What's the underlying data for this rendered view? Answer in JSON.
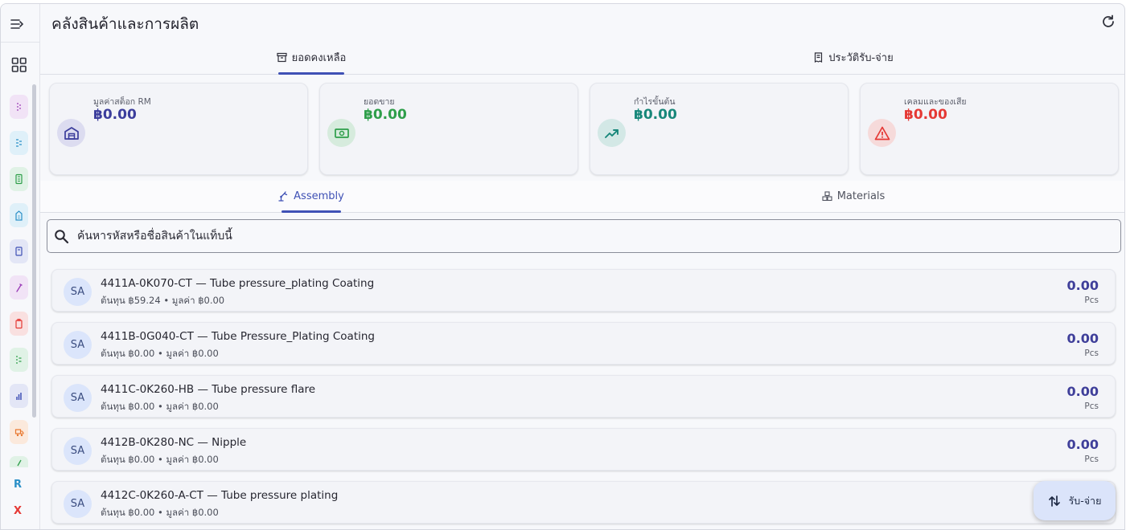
{
  "header": {
    "title": "คลังสินค้าและการผลิต"
  },
  "top_tabs": [
    {
      "label": "ยอดคงเหลือ",
      "icon": "archive-icon",
      "active": true
    },
    {
      "label": "ประวัติรับ-จ่าย",
      "icon": "receipt-icon",
      "active": false
    }
  ],
  "stats": [
    {
      "label": "มูลค่าสต็อก RM",
      "value": "฿0.00",
      "icon": "warehouse-icon",
      "color": "#3b3d9c",
      "icon_bg": "#dcdcf0"
    },
    {
      "label": "ยอดขาย",
      "value": "฿0.00",
      "icon": "cash-icon",
      "color": "#2e9e4a",
      "icon_bg": "#d6ebdd"
    },
    {
      "label": "กำไรขั้นต้น",
      "value": "฿0.00",
      "icon": "trending-up-icon",
      "color": "#17877a",
      "icon_bg": "#d3e8e6"
    },
    {
      "label": "เคลมและของเสีย",
      "value": "฿0.00",
      "icon": "warning-icon",
      "color": "#e53935",
      "icon_bg": "#f6dada"
    }
  ],
  "sub_tabs": [
    {
      "label": "Assembly",
      "icon": "assembly-icon",
      "active": true
    },
    {
      "label": "Materials",
      "icon": "materials-icon",
      "active": false
    }
  ],
  "search": {
    "placeholder": "ค้นหารหัสหรือชื่อสินค้าในแท็บนี้"
  },
  "items": [
    {
      "avatar": "SA",
      "title": "4411A-0K070-CT — Tube pressure_plating Coating",
      "subtitle": "ต้นทุน ฿59.24 • มูลค่า ฿0.00",
      "qty": "0.00",
      "unit": "Pcs"
    },
    {
      "avatar": "SA",
      "title": "4411B-0G040-CT — Tube Pressure_Plating Coating",
      "subtitle": "ต้นทุน ฿0.00 • มูลค่า ฿0.00",
      "qty": "0.00",
      "unit": "Pcs"
    },
    {
      "avatar": "SA",
      "title": "4411C-0K260-HB — Tube pressure flare",
      "subtitle": "ต้นทุน ฿0.00 • มูลค่า ฿0.00",
      "qty": "0.00",
      "unit": "Pcs"
    },
    {
      "avatar": "SA",
      "title": "4412B-0K280-NC — Nipple",
      "subtitle": "ต้นทุน ฿0.00 • มูลค่า ฿0.00",
      "qty": "0.00",
      "unit": "Pcs"
    },
    {
      "avatar": "SA",
      "title": "4412C-0K260-A-CT — Tube pressure plating",
      "subtitle": "ต้นทุน ฿0.00 • มูลค่า ฿0.00",
      "qty": "",
      "unit": ""
    }
  ],
  "sidebar": {
    "icons": [
      {
        "name": "menu-list-icon",
        "color": "#9c3fb8",
        "bg": "#f1e3f6"
      },
      {
        "name": "list-icon",
        "color": "#2a8fc7",
        "bg": "#dff0f9"
      },
      {
        "name": "calculator-icon",
        "color": "#2e9e4a",
        "bg": "#e0f2e6"
      },
      {
        "name": "building-icon",
        "color": "#2a8fc7",
        "bg": "#dff0f9"
      },
      {
        "name": "document-icon",
        "color": "#3f51b5",
        "bg": "#e3e6f6"
      },
      {
        "name": "tool-icon",
        "color": "#9c3fb8",
        "bg": "#f1e3f6"
      },
      {
        "name": "clipboard-icon",
        "color": "#e53935",
        "bg": "#f9e0e0"
      },
      {
        "name": "checklist-icon",
        "color": "#2e9e4a",
        "bg": "#e0f2e6"
      },
      {
        "name": "bar-chart-icon",
        "color": "#3f51b5",
        "bg": "#e3e6f6"
      },
      {
        "name": "truck-icon",
        "color": "#e8772e",
        "bg": "#fbe9dc"
      },
      {
        "name": "extra-icon",
        "color": "#2e9e4a",
        "bg": "#e0f2e6"
      }
    ],
    "letters": [
      {
        "text": "R",
        "color": "#2a8fc7"
      },
      {
        "text": "X",
        "color": "#e53935"
      }
    ]
  },
  "fab": {
    "label": "รับ-จ่าย",
    "icon": "swap-vertical-icon"
  }
}
